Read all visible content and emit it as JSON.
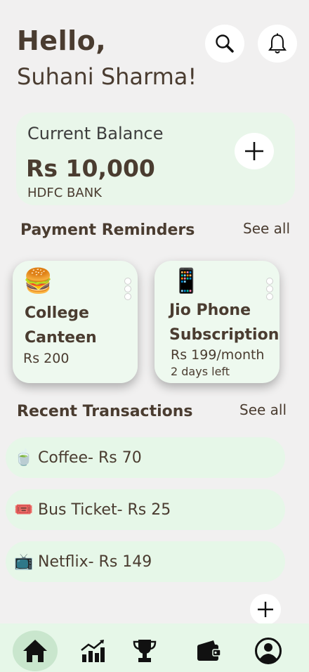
{
  "header": {
    "greeting": "Hello,",
    "user_name": "Suhani Sharma!",
    "search_icon": "search-icon",
    "notification_icon": "bell-icon"
  },
  "balance": {
    "label": "Current Balance",
    "amount": "Rs 10,000",
    "bank": "HDFC BANK",
    "add_icon": "plus-icon"
  },
  "reminders": {
    "title": "Payment Reminders",
    "see_all": "See all",
    "items": [
      {
        "emoji": "🍔",
        "title_line1": "College",
        "title_line2": "Canteen",
        "amount": "Rs 200",
        "note": ""
      },
      {
        "emoji": "📱",
        "title_line1": "Jio Phone",
        "title_line2": "Subscription",
        "amount": "Rs 199/month",
        "note": "2 days left"
      }
    ]
  },
  "transactions": {
    "title": "Recent Transactions",
    "see_all": "See all",
    "items": [
      {
        "emoji": "🍵",
        "text": "Coffee- Rs 70"
      },
      {
        "emoji": "🎟️",
        "text": "Bus Ticket- Rs 25"
      },
      {
        "emoji": "📺",
        "text": "Netflix- Rs 149"
      }
    ]
  },
  "nav": {
    "items": [
      "home-icon",
      "chart-icon",
      "trophy-icon",
      "wallet-icon",
      "profile-icon"
    ],
    "active": "home-icon"
  },
  "colors": {
    "background": "#f1f0f0",
    "card": "#e9f6ea",
    "text": "#4a3c30",
    "nav_active": "#c9e6cd"
  }
}
